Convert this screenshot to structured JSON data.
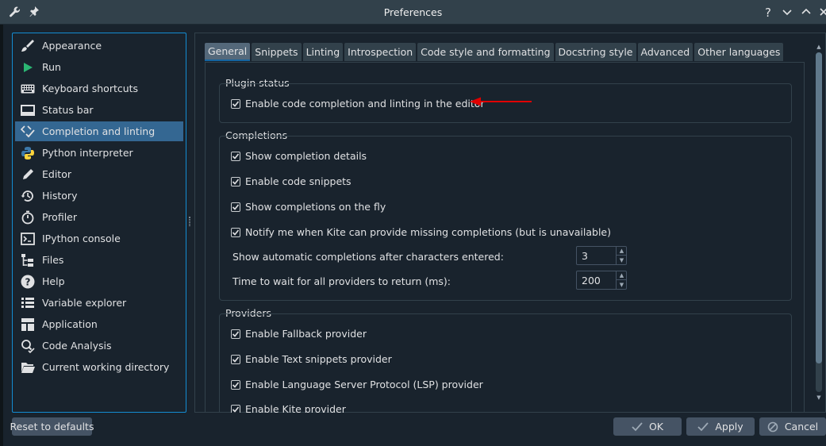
{
  "window": {
    "title": "Preferences",
    "icon": "wrench-icon",
    "pin_icon": "pin-icon",
    "help_label": "?",
    "controls": [
      "help-icon",
      "minimize-icon",
      "maximize-icon",
      "close-icon"
    ]
  },
  "sidebar": {
    "items": [
      {
        "label": "Appearance",
        "icon": "paintbrush-icon"
      },
      {
        "label": "Run",
        "icon": "play-icon"
      },
      {
        "label": "Keyboard shortcuts",
        "icon": "keyboard-icon"
      },
      {
        "label": "Status bar",
        "icon": "statusbar-icon"
      },
      {
        "label": "Completion and linting",
        "icon": "code-check-icon",
        "selected": true
      },
      {
        "label": "Python interpreter",
        "icon": "python-icon"
      },
      {
        "label": "Editor",
        "icon": "pencil-icon"
      },
      {
        "label": "History",
        "icon": "history-icon"
      },
      {
        "label": "Profiler",
        "icon": "stopwatch-icon"
      },
      {
        "label": "IPython console",
        "icon": "console-icon"
      },
      {
        "label": "Files",
        "icon": "files-tree-icon"
      },
      {
        "label": "Help",
        "icon": "help-circle-icon"
      },
      {
        "label": "Variable explorer",
        "icon": "table-list-icon"
      },
      {
        "label": "Application",
        "icon": "layout-icon"
      },
      {
        "label": "Code Analysis",
        "icon": "magnify-check-icon"
      },
      {
        "label": "Current working directory",
        "icon": "folder-open-icon"
      }
    ]
  },
  "tabs": [
    {
      "label": "General",
      "active": true
    },
    {
      "label": "Snippets"
    },
    {
      "label": "Linting"
    },
    {
      "label": "Introspection"
    },
    {
      "label": "Code style and formatting"
    },
    {
      "label": "Docstring style"
    },
    {
      "label": "Advanced"
    },
    {
      "label": "Other languages"
    }
  ],
  "plugin_status": {
    "title": "Plugin status",
    "checkboxes": [
      {
        "label": "Enable code completion and linting in the editor",
        "checked": true
      }
    ]
  },
  "completions": {
    "title": "Completions",
    "checkboxes": [
      {
        "label": "Show completion details",
        "checked": true
      },
      {
        "label": "Enable code snippets",
        "checked": true
      },
      {
        "label": "Show completions on the fly",
        "checked": true
      },
      {
        "label": "Notify me when Kite can provide missing completions (but is unavailable)",
        "checked": true
      }
    ],
    "chars_label": "Show automatic completions after characters entered:",
    "chars_value": "3",
    "wait_label": "Time to wait for all providers to return (ms):",
    "wait_value": "200"
  },
  "providers": {
    "title": "Providers",
    "checkboxes": [
      {
        "label": "Enable Fallback provider",
        "checked": true
      },
      {
        "label": "Enable Text snippets provider",
        "checked": true
      },
      {
        "label": "Enable Language Server Protocol (LSP) provider",
        "checked": true
      },
      {
        "label": "Enable Kite provider",
        "checked": true
      }
    ]
  },
  "buttons": {
    "reset": "Reset to defaults",
    "ok": "OK",
    "apply": "Apply",
    "cancel": "Cancel"
  },
  "colors": {
    "accent": "#148cd2",
    "selection": "#346792",
    "annotation_arrow": "#e00000"
  }
}
